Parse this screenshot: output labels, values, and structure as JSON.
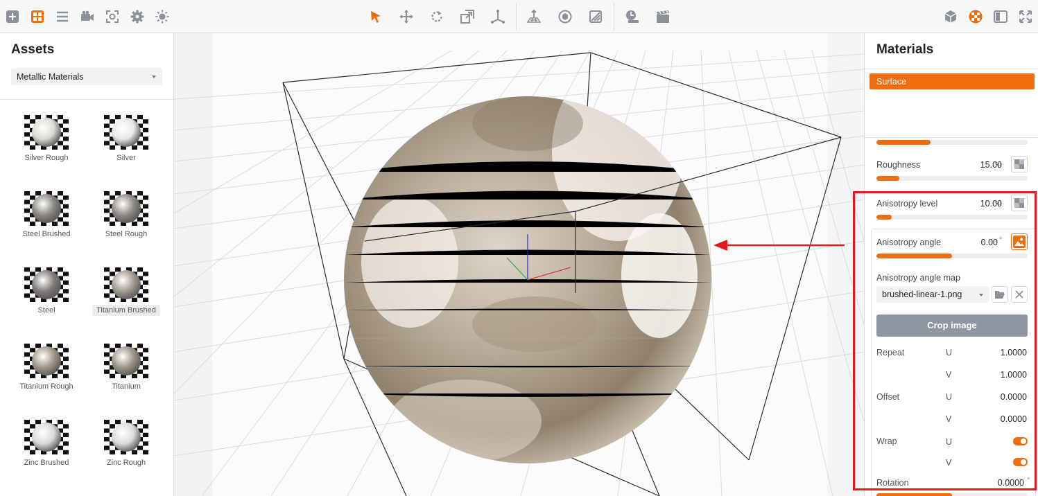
{
  "toolbar": {
    "left_tools": [
      "add-icon",
      "layout-grid-icon",
      "list-icon",
      "camera-icon",
      "focus-frame-icon",
      "gear-icon",
      "light-bulb-icon"
    ],
    "center_tools": [
      "select-arrow-icon",
      "move-icon",
      "rotate-icon",
      "scale-icon",
      "pivot-icon",
      "floor-grid-icon",
      "view-sphere-icon",
      "texture-icon",
      "environment-icon",
      "clapperboard-icon"
    ],
    "right_tools": [
      "cube-icon",
      "material-ball-icon",
      "panel-layout-icon",
      "expand-icon"
    ],
    "accent_color": "#ee6d0e"
  },
  "assets": {
    "title": "Assets",
    "category": "Metallic Materials",
    "items": [
      {
        "label": "Silver Rough",
        "tone": "#dcdad4"
      },
      {
        "label": "Silver",
        "tone": "#e8e8e6"
      },
      {
        "label": "Steel Brushed",
        "tone": "#8a8781"
      },
      {
        "label": "Steel Rough",
        "tone": "#8e8a84"
      },
      {
        "label": "Steel",
        "tone": "#7f7c78"
      },
      {
        "label": "Titanium Brushed",
        "tone": "#a39a8e"
      },
      {
        "label": "Titanium Rough",
        "tone": "#a19788"
      },
      {
        "label": "Titanium",
        "tone": "#9d9485"
      },
      {
        "label": "Zinc Brushed",
        "tone": "#d8d9da"
      },
      {
        "label": "Zinc Rough",
        "tone": "#dadbdc"
      }
    ],
    "selected": "Titanium Brushed"
  },
  "materials": {
    "title": "Materials",
    "tab": "Surface",
    "first_slider_fill": 0.36,
    "roughness": {
      "label": "Roughness",
      "value": "15.00",
      "unit": "%",
      "fill": 0.15
    },
    "anisotropy_level": {
      "label": "Anisotropy level",
      "value": "10.00",
      "unit": "%",
      "fill": 0.1
    },
    "anisotropy_angle": {
      "label": "Anisotropy angle",
      "value": "0.00",
      "unit": "°",
      "fill": 0.5
    },
    "angle_map": {
      "label": "Anisotropy angle map",
      "file": "brushed-linear-1.png"
    },
    "crop_button": "Crop image",
    "repeat": {
      "label": "Repeat",
      "u_label": "U",
      "u": "1.0000",
      "v_label": "V",
      "v": "1.0000"
    },
    "offset": {
      "label": "Offset",
      "u_label": "U",
      "u": "0.0000",
      "v_label": "V",
      "v": "0.0000"
    },
    "wrap": {
      "label": "Wrap",
      "u_label": "U",
      "u": true,
      "v_label": "V",
      "v": true
    },
    "rotation": {
      "label": "Rotation",
      "value": "0.0000",
      "unit": "°"
    }
  }
}
